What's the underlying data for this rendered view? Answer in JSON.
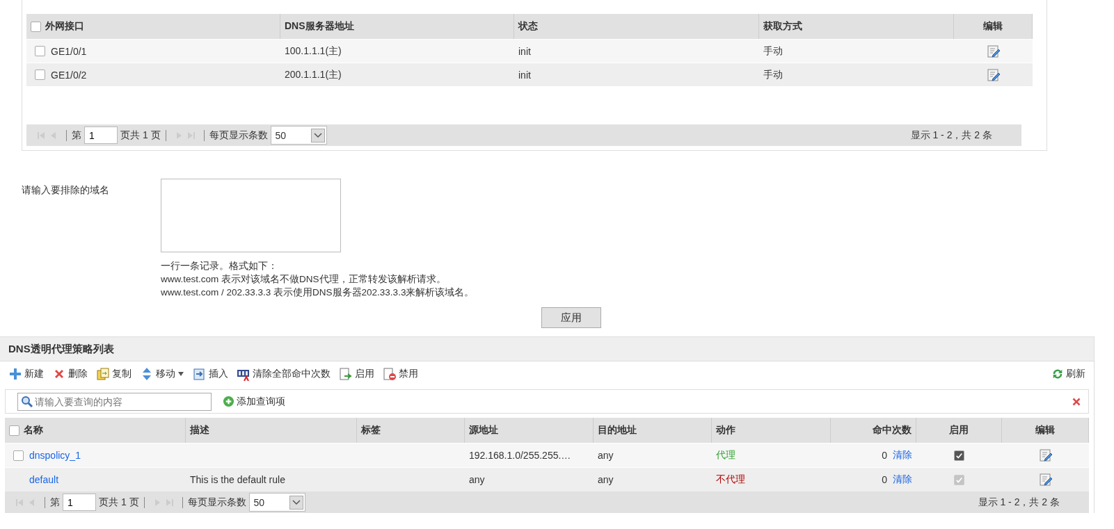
{
  "interface_table": {
    "all_selected": false,
    "columns": [
      "外网接口",
      "DNS服务器地址",
      "状态",
      "获取方式",
      "编辑"
    ],
    "rows": [
      {
        "selected": false,
        "interface": "GE1/0/1",
        "dns_server": "100.1.1.1(主)",
        "status": "init",
        "method": "手动"
      },
      {
        "selected": false,
        "interface": "GE1/0/2",
        "dns_server": "200.1.1.1(主)",
        "status": "init",
        "method": "手动"
      }
    ],
    "pager": {
      "page_label": "第",
      "page": "1",
      "total_pages": "页共 1 页",
      "per_page_label": "每页显示条数",
      "per_page": "50",
      "summary": "显示 1 - 2，共 2 条"
    }
  },
  "exclude_domains": {
    "label": "请输入要排除的域名",
    "help": [
      "一行一条记录。格式如下：",
      "www.test.com 表示对该域名不做DNS代理，正常转发该解析请求。",
      "www.test.com / 202.33.3.3 表示使用DNS服务器202.33.3.3来解析该域名。"
    ],
    "apply_button": "应用"
  },
  "policy_list": {
    "title": "DNS透明代理策略列表",
    "toolbar": [
      {
        "kind": "plus",
        "label": "新建"
      },
      {
        "kind": "delete",
        "label": "删除"
      },
      {
        "kind": "copy",
        "label": "复制"
      },
      {
        "kind": "move",
        "label": "移动"
      },
      {
        "kind": "insert",
        "label": "插入"
      },
      {
        "kind": "counter",
        "label": "清除全部命中次数"
      },
      {
        "kind": "enable",
        "label": "启用"
      },
      {
        "kind": "disable",
        "label": "禁用"
      }
    ],
    "refresh": "刷新",
    "search": {
      "placeholder": "请输入要查询的内容"
    },
    "add_query": "添加查询项",
    "all_selected": false,
    "columns": [
      "名称",
      "描述",
      "标签",
      "源地址",
      "目的地址",
      "动作",
      "命中次数",
      "启用",
      "编辑"
    ],
    "rows": [
      {
        "selected": false,
        "name": "dnspolicy_1",
        "source": "192.168.1.0/255.255.…",
        "destination": "any",
        "action": "代理",
        "color": "#2ea02e",
        "hits": "0",
        "clear": "清除",
        "enabled": true,
        "disabled": false
      },
      {
        "name": "default",
        "description": "This is the default rule",
        "source": "any",
        "destination": "any",
        "action": "不代理",
        "color": "#b00000",
        "hits": "0",
        "clear": "清除",
        "enabled": true,
        "disabled": true
      }
    ],
    "pager": {
      "page_label": "第",
      "page": "1",
      "total_pages": "页共 1 页",
      "per_page_label": "每页显示条数",
      "per_page": "50",
      "summary": "显示 1 - 2，共 2 条"
    }
  }
}
